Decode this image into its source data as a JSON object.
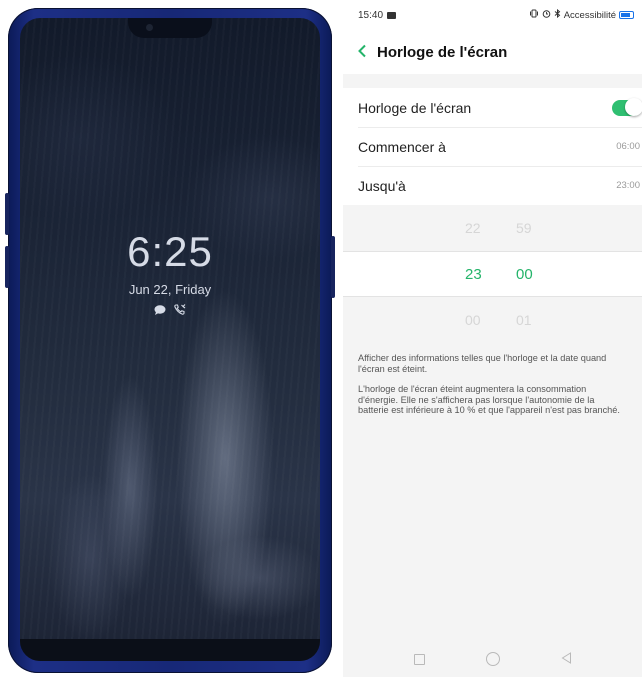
{
  "lockscreen": {
    "time": "6:25",
    "date": "Jun 22, Friday",
    "icons": [
      "chat-bubble-icon",
      "missed-call-icon"
    ]
  },
  "statusbar": {
    "time": "15:40",
    "accessibility": "Accessibilité",
    "icons": [
      "image-icon",
      "vibrate-icon",
      "alarm-icon",
      "bluetooth-icon",
      "battery-icon"
    ]
  },
  "header": {
    "title": "Horloge de l'écran"
  },
  "settings": {
    "toggle_label": "Horloge de l'écran",
    "toggle_on": true,
    "start_label": "Commencer à",
    "start_value": "06:00",
    "end_label": "Jusqu'à",
    "end_value": "23:00"
  },
  "picker": {
    "rows": [
      {
        "hour": "22",
        "minute": "59"
      },
      {
        "hour": "23",
        "minute": "00"
      },
      {
        "hour": "00",
        "minute": "01"
      }
    ]
  },
  "description": {
    "p1": "Afficher des informations telles que l'horloge et la date quand l'écran est éteint.",
    "p2": "L'horloge de l'écran éteint augmentera la consommation d'énergie. Elle ne s'affichera pas lorsque l'autonomie de la batterie est inférieure à 10 % et que l'appareil n'est pas branché."
  },
  "colors": {
    "accent": "#24b46a",
    "background": "#f4f4f4"
  }
}
